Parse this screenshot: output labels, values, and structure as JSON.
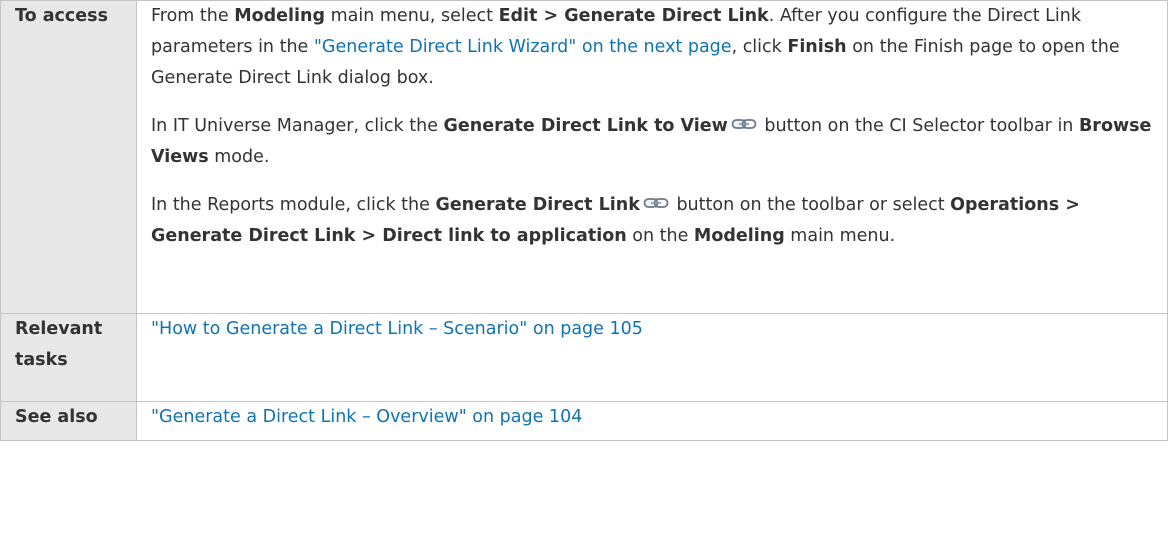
{
  "rows": {
    "access": {
      "header": "To access",
      "p1": {
        "t1": "From the ",
        "b1": "Modeling",
        "t2": " main menu, select ",
        "b2": "Edit > Generate Direct Link",
        "t3": ". After you configure the Direct Link parameters in the ",
        "link": "\"Generate Direct Link Wizard\" on the next page",
        "t4": ", click ",
        "b3": "Finish",
        "t5": " on the Finish page to open the Generate Direct Link dialog box."
      },
      "p2": {
        "t1": "In IT Universe Manager, click the ",
        "b1": "Generate Direct Link to View",
        "icon": "direct-link-icon",
        "t2": " button on the CI Selector toolbar in ",
        "b2": "Browse Views",
        "t3": " mode."
      },
      "p3": {
        "t1": "In the Reports module, click the ",
        "b1": "Generate Direct Link",
        "icon": "direct-link-icon",
        "t2": " button on the toolbar or select ",
        "b2": "Operations > Generate Direct Link > Direct link to application",
        "t3": " on the ",
        "b3": "Modeling",
        "t4": " main menu."
      }
    },
    "tasks": {
      "header": "Relevant tasks",
      "link": "\"How to Generate a Direct Link – Scenario\" on page 105"
    },
    "see_also": {
      "header": "See also",
      "link": "\"Generate a Direct Link – Overview\" on page 104"
    }
  },
  "colors": {
    "link": "#0f73b4",
    "header_bg": "#e8e8e8",
    "border": "#c4c4c4",
    "text": "#333333"
  }
}
